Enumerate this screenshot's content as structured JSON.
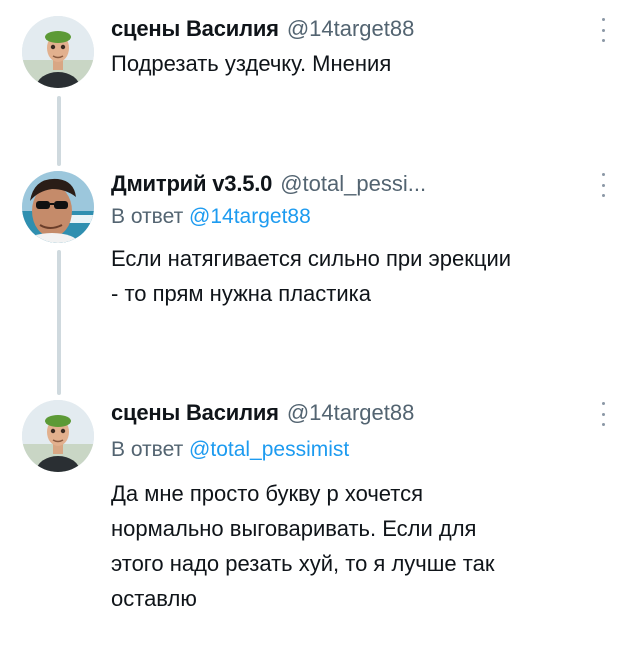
{
  "tweets": [
    {
      "author_name": "сцены Василия",
      "author_handle": "@14target88",
      "reply_label": "",
      "reply_mention": "",
      "text": "Подрезать уздечку. Мнения",
      "avatar": "avatar-man-green-cap-icon"
    },
    {
      "author_name": "Дмитрий v3.5.0",
      "author_handle": "@total_pessi...",
      "reply_label": "В ответ",
      "reply_mention": "@14target88",
      "text": "Если натягивается сильно при эрекции\n- то прям нужна пластика",
      "avatar": "avatar-man-sunglasses-icon"
    },
    {
      "author_name": "сцены Василия",
      "author_handle": "@14target88",
      "reply_label": "В ответ",
      "reply_mention": "@total_pessimist",
      "text": "Да мне просто букву р хочется\nнормально выговаривать. Если для\nэтого надо резать хуй, то я лучше так\nоставлю",
      "avatar": "avatar-man-green-cap-icon"
    }
  ],
  "colors": {
    "name": "#0f1419",
    "handle": "#536471",
    "mention": "#1d9bf0",
    "thread_line": "#cfd9de"
  }
}
